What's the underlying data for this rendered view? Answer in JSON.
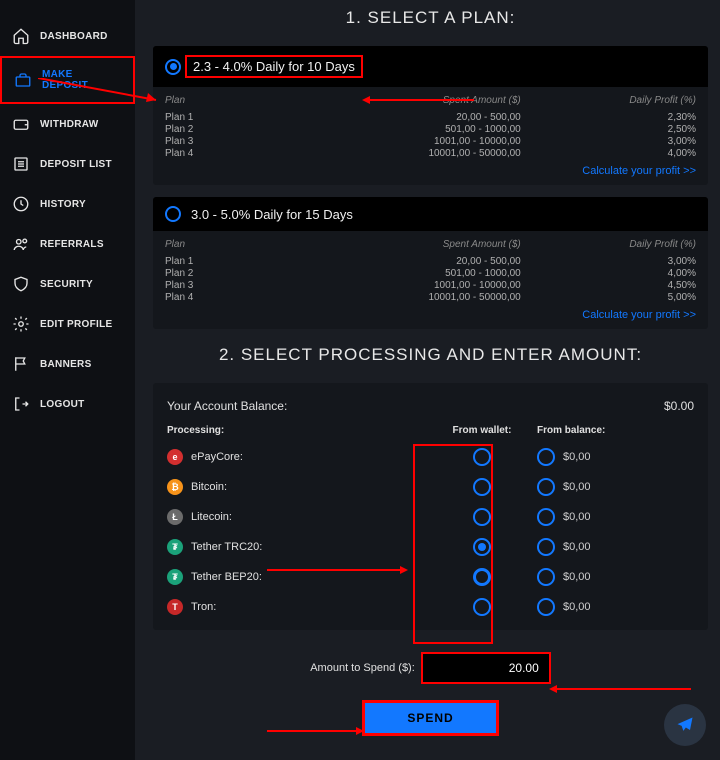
{
  "sidebar": {
    "items": [
      {
        "label": "DASHBOARD"
      },
      {
        "label": "MAKE DEPOSIT"
      },
      {
        "label": "WITHDRAW"
      },
      {
        "label": "DEPOSIT LIST"
      },
      {
        "label": "HISTORY"
      },
      {
        "label": "REFERRALS"
      },
      {
        "label": "SECURITY"
      },
      {
        "label": "EDIT PROFILE"
      },
      {
        "label": "BANNERS"
      },
      {
        "label": "LOGOUT"
      }
    ]
  },
  "headings": {
    "select_plan": "1. SELECT A PLAN:",
    "select_processing": "2. SELECT PROCESSING AND ENTER AMOUNT:"
  },
  "plans": [
    {
      "title": "2.3 - 4.0% Daily for 10 Days",
      "selected": true,
      "columns": {
        "plan": "Plan",
        "spent": "Spent Amount ($)",
        "profit": "Daily Profit (%)"
      },
      "rows": [
        {
          "plan": "Plan 1",
          "spent": "20,00 - 500,00",
          "profit": "2,30%"
        },
        {
          "plan": "Plan 2",
          "spent": "501,00 - 1000,00",
          "profit": "2,50%"
        },
        {
          "plan": "Plan 3",
          "spent": "1001,00 - 10000,00",
          "profit": "3,00%"
        },
        {
          "plan": "Plan 4",
          "spent": "10001,00 - 50000,00",
          "profit": "4,00%"
        }
      ],
      "calc_link": "Calculate your profit >>"
    },
    {
      "title": "3.0 - 5.0% Daily for 15 Days",
      "selected": false,
      "columns": {
        "plan": "Plan",
        "spent": "Spent Amount ($)",
        "profit": "Daily Profit (%)"
      },
      "rows": [
        {
          "plan": "Plan 1",
          "spent": "20,00 - 500,00",
          "profit": "3,00%"
        },
        {
          "plan": "Plan 2",
          "spent": "501,00 - 1000,00",
          "profit": "4,00%"
        },
        {
          "plan": "Plan 3",
          "spent": "1001,00 - 10000,00",
          "profit": "4,50%"
        },
        {
          "plan": "Plan 4",
          "spent": "10001,00 - 50000,00",
          "profit": "5,00%"
        }
      ],
      "calc_link": "Calculate your profit >>"
    }
  ],
  "processing": {
    "balance_label": "Your Account Balance:",
    "balance_value": "$0.00",
    "columns": {
      "processing": "Processing:",
      "wallet": "From wallet:",
      "balance": "From balance:"
    },
    "rows": [
      {
        "name": "ePayCore:",
        "color": "#d32f2f",
        "glyph": "e",
        "balance": "$0,00"
      },
      {
        "name": "Bitcoin:",
        "color": "#f7931a",
        "glyph": "₿",
        "balance": "$0,00"
      },
      {
        "name": "Litecoin:",
        "color": "#6b6b6b",
        "glyph": "Ł",
        "balance": "$0,00"
      },
      {
        "name": "Tether TRC20:",
        "color": "#1ba27a",
        "glyph": "₮",
        "balance": "$0,00"
      },
      {
        "name": "Tether BEP20:",
        "color": "#1ba27a",
        "glyph": "₮",
        "balance": "$0,00"
      },
      {
        "name": "Tron:",
        "color": "#c62828",
        "glyph": "T",
        "balance": "$0,00"
      }
    ],
    "selected_wallet_index": 3
  },
  "amount": {
    "label": "Amount to Spend ($):",
    "value": "20.00"
  },
  "spend_label": "SPEND"
}
